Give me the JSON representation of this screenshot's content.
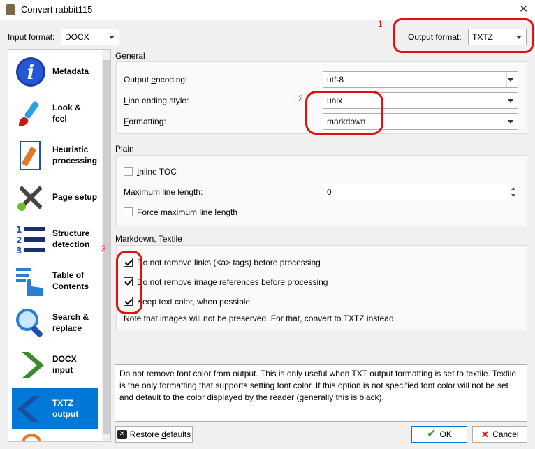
{
  "window": {
    "title": "Convert rabbit115"
  },
  "input_format": {
    "label": "Input format:",
    "value": "DOCX"
  },
  "output_format": {
    "label": "Output format:",
    "value": "TXTZ"
  },
  "sidebar": {
    "items": [
      {
        "label": "Metadata",
        "icon": "info-icon"
      },
      {
        "label": "Look &\nfeel",
        "icon": "paintbrush-icon"
      },
      {
        "label": "Heuristic\nprocessing",
        "icon": "document-pencil-icon"
      },
      {
        "label": "Page setup",
        "icon": "tools-icon"
      },
      {
        "label": "Structure\ndetection",
        "icon": "numbered-list-icon"
      },
      {
        "label": "Table of\nContents",
        "icon": "toc-hand-icon"
      },
      {
        "label": "Search &\nreplace",
        "icon": "magnifier-icon"
      },
      {
        "label": "DOCX\ninput",
        "icon": "arrow-right-icon"
      },
      {
        "label": "TXTZ\noutput",
        "icon": "arrow-left-icon"
      }
    ]
  },
  "general": {
    "title": "General",
    "output_encoding": {
      "label": "Output encoding:",
      "value": "utf-8"
    },
    "line_ending": {
      "label": "Line ending style:",
      "value": "unix"
    },
    "formatting": {
      "label": "Formatting:",
      "value": "markdown"
    }
  },
  "plain": {
    "title": "Plain",
    "inline_toc": {
      "label": "Inline TOC",
      "checked": false
    },
    "max_line_length": {
      "label": "Maximum line length:",
      "value": "0"
    },
    "force_max": {
      "label": "Force maximum line length",
      "checked": false
    }
  },
  "markdown": {
    "title": "Markdown, Textile",
    "opt1": {
      "label": "Do not remove links (<a> tags) before processing",
      "checked": true
    },
    "opt2": {
      "label": "Do not remove image references before processing",
      "checked": true
    },
    "opt3": {
      "label": "Keep text color, when possible",
      "checked": true
    },
    "note": "Note that images will not be preserved. For that, convert to TXTZ instead."
  },
  "description": "Do not remove font color from output. This is only useful when TXT output formatting is set to textile. Textile is the only formatting that supports setting font color. If this option is not specified font color will not be set and default to the color displayed by the reader (generally this is black).",
  "buttons": {
    "restore": "Restore defaults",
    "ok": "OK",
    "cancel": "Cancel"
  },
  "annotations": {
    "a1": "1",
    "a2": "2",
    "a3": "3"
  },
  "colors": {
    "accent": "#0078d7",
    "annotation": "#e01010",
    "ok_check": "#2e9e2e",
    "cancel_x": "#d02020"
  }
}
